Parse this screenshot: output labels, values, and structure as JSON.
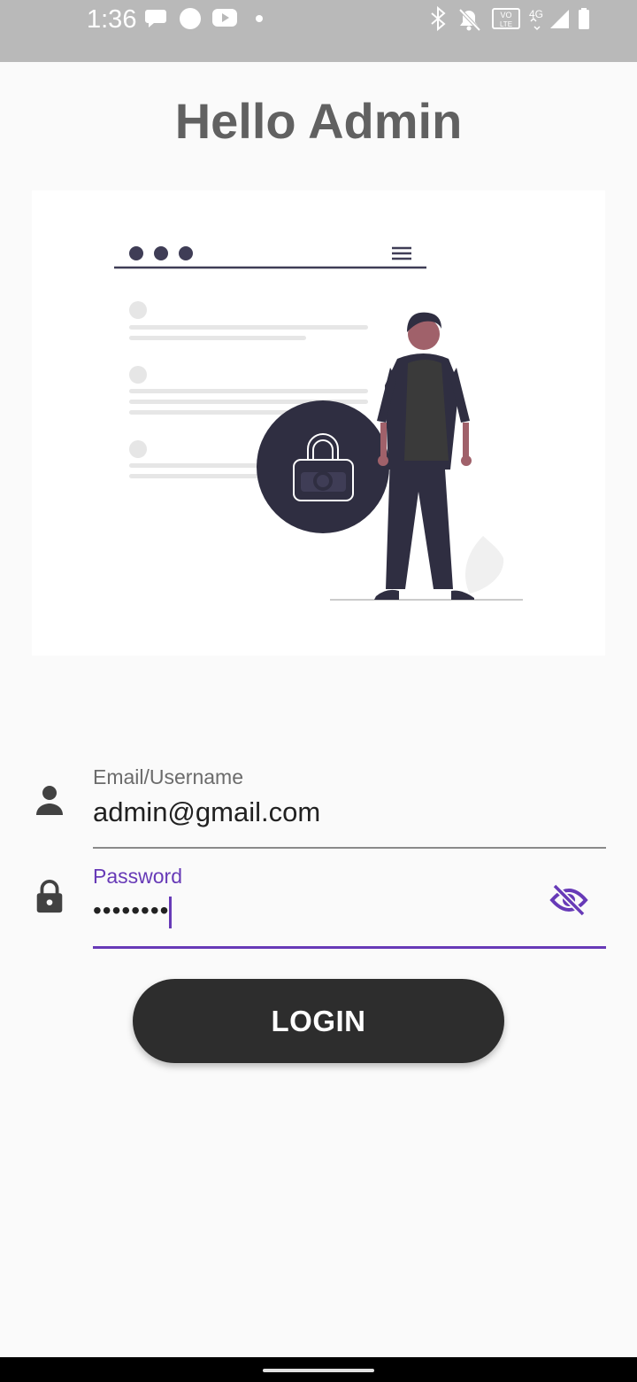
{
  "status_bar": {
    "time": "1:36",
    "left_icons": [
      "chat-bubble-icon",
      "circle-notification-icon",
      "youtube-icon",
      "dot-icon"
    ],
    "right_icons": [
      "bluetooth-icon",
      "bell-off-icon",
      "volte-icon",
      "4g-icon",
      "signal-icon",
      "battery-icon"
    ]
  },
  "header": {
    "title": "Hello Admin"
  },
  "illustration": {
    "name": "secure-login-illustration"
  },
  "form": {
    "email": {
      "label": "Email/Username",
      "value": "admin@gmail.com",
      "icon": "person-icon"
    },
    "password": {
      "label": "Password",
      "value": "••••••••",
      "icon": "lock-icon",
      "toggle_icon": "visibility-off-icon"
    },
    "login_label": "LOGIN"
  },
  "colors": {
    "accent": "#673ab7",
    "button": "#2d2d2d",
    "status_bar": "#b9b9b9",
    "title": "#616161"
  }
}
